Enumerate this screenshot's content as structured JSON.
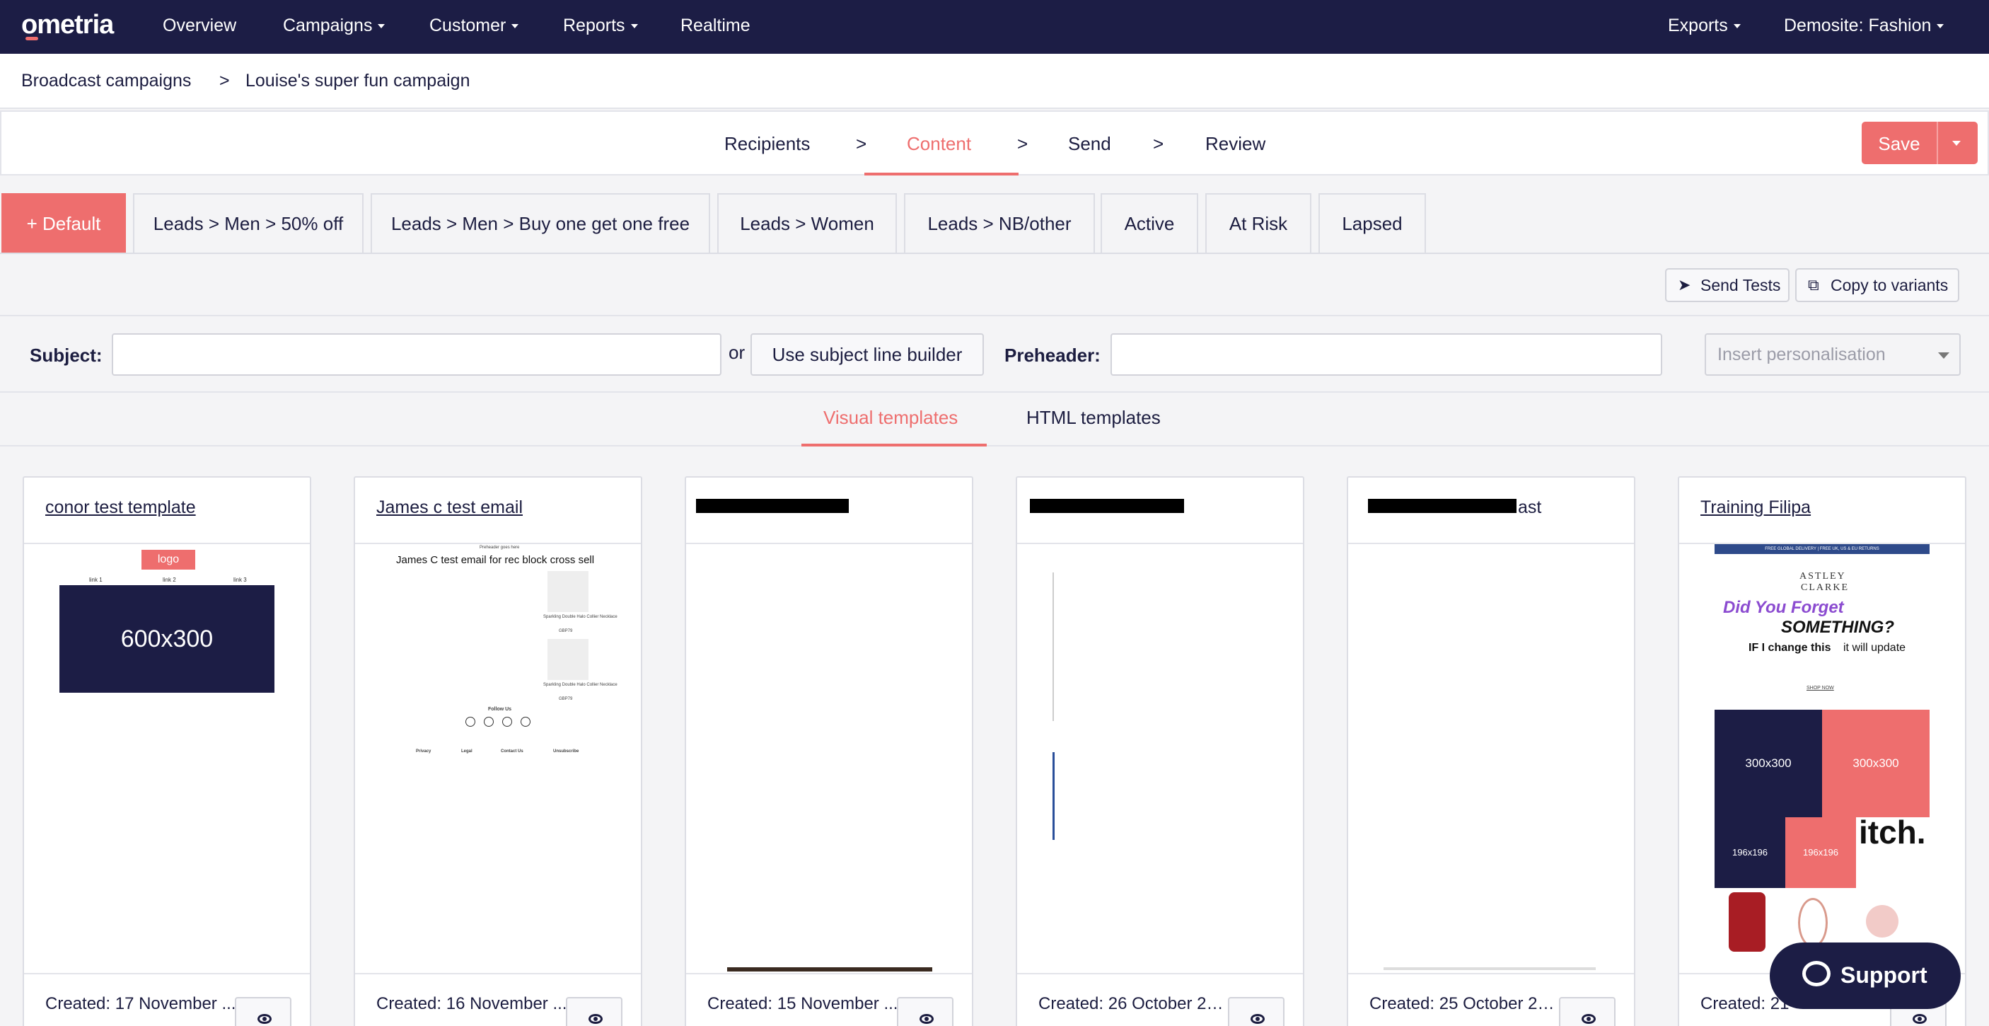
{
  "nav": {
    "logo": "ometria",
    "items": [
      {
        "label": "Overview",
        "dropdown": false
      },
      {
        "label": "Campaigns",
        "dropdown": true
      },
      {
        "label": "Customer",
        "dropdown": true
      },
      {
        "label": "Reports",
        "dropdown": true
      },
      {
        "label": "Realtime",
        "dropdown": false
      }
    ],
    "exports": "Exports",
    "account": "Demosite: Fashion"
  },
  "breadcrumb": {
    "parent": "Broadcast campaigns",
    "separator": ">",
    "current": "Louise's super fun campaign"
  },
  "steps": {
    "items": [
      "Recipients",
      "Content",
      "Send",
      "Review"
    ],
    "active": "Content",
    "separator": ">",
    "save_label": "Save"
  },
  "variants": {
    "default_label": "+ Default",
    "tabs": [
      "Leads > Men > 50% off",
      "Leads > Men > Buy one get one free",
      "Leads > Women",
      "Leads > NB/other",
      "Active",
      "At Risk",
      "Lapsed"
    ]
  },
  "tools": {
    "send_tests": "Send Tests",
    "copy_to_variants": "Copy to variants"
  },
  "subject_row": {
    "subject_label": "Subject:",
    "subject_value": "",
    "or_text": "or",
    "builder_button": "Use subject line builder",
    "preheader_label": "Preheader:",
    "preheader_value": "",
    "personalisation_placeholder": "Insert personalisation"
  },
  "template_tabs": {
    "visual": "Visual templates",
    "html": "HTML templates",
    "active": "Visual templates"
  },
  "cards": [
    {
      "title": "conor test template",
      "created": "Created: 17 November ...",
      "redacted": false
    },
    {
      "title": "James c test email",
      "created": "Created: 16 November ...",
      "redacted": false
    },
    {
      "title": "",
      "created": "Created: 15 November ...",
      "redacted": true
    },
    {
      "title": "",
      "created": "Created: 26 October 20...",
      "redacted": true
    },
    {
      "title": "ast",
      "created": "Created: 25 October 20...",
      "redacted": true
    },
    {
      "title": "Training Filipa",
      "created": "Created: 21",
      "redacted": false
    }
  ],
  "previews": {
    "conor": {
      "logo": "logo",
      "links": [
        "link 1",
        "link 2",
        "link 3"
      ],
      "placeholder": "600x300"
    },
    "james": {
      "preheader": "Preheader goes here",
      "headline": "James C test email for rec block cross sell",
      "product": "Sparkling Double Halo Collier Necklace",
      "price": "GBP79",
      "follow": "Follow Us",
      "footer_links": [
        "Privacy",
        "Legal",
        "Contact Us",
        "Unsubscribe"
      ]
    },
    "training": {
      "banner": "FREE GLOBAL DELIVERY | FREE UK, US & EU RETURNS",
      "brand_line1": "ASTLEY",
      "brand_line2": "CLARKE",
      "headline1": "Did You Forget",
      "headline2": "SOMETHING?",
      "subline_a": "IF I change this",
      "subline_b": "it will update",
      "shop": "SHOP NOW",
      "box1": "300x300",
      "box2": "300x300",
      "box3": "196x196",
      "box4": "196x196",
      "word": "itch."
    }
  },
  "support": {
    "label": "Support"
  },
  "colors": {
    "navy": "#1c1d45",
    "accent": "#ee6e6e",
    "background": "#f4f4f6"
  }
}
